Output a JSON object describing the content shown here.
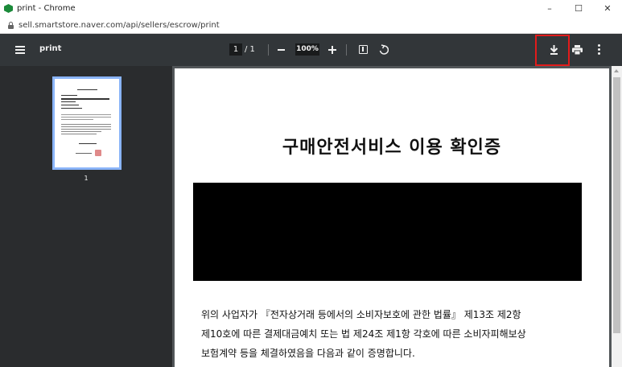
{
  "window": {
    "title": "print - Chrome",
    "controls": {
      "minimize": "–",
      "maximize": "☐",
      "close": "✕"
    }
  },
  "address_bar": {
    "url": "sell.smartstore.naver.com/api/sellers/escrow/print"
  },
  "toolbar": {
    "doc_name": "print",
    "current_page": "1",
    "page_separator": "/ 1",
    "zoom": "100%",
    "icons": [
      "menu-icon",
      "zoom-out-icon",
      "zoom-in-icon",
      "fit-page-icon",
      "rotate-icon",
      "download-icon",
      "print-icon",
      "more-icon"
    ]
  },
  "sidebar": {
    "thumbnails": [
      {
        "page_number": "1"
      }
    ]
  },
  "document": {
    "title": "구매안전서비스 이용 확인증",
    "paragraph_lines": [
      "위의 사업자가 『전자상거래 등에서의 소비자보호에 관한 법률』 제13조 제2항",
      "제10호에 따른 결제대금예치 또는 법 제24조 제1항 각호에 따른 소비자피해보상",
      "보험계약 등을 체결하였음을 다음과 같이 증명합니다."
    ]
  },
  "colors": {
    "toolbar_bg": "#323639",
    "sidebar_bg": "#2a2c2e",
    "viewer_bg": "#525659",
    "highlight": "#e21b1b",
    "thumb_border": "#8ab4f8"
  }
}
